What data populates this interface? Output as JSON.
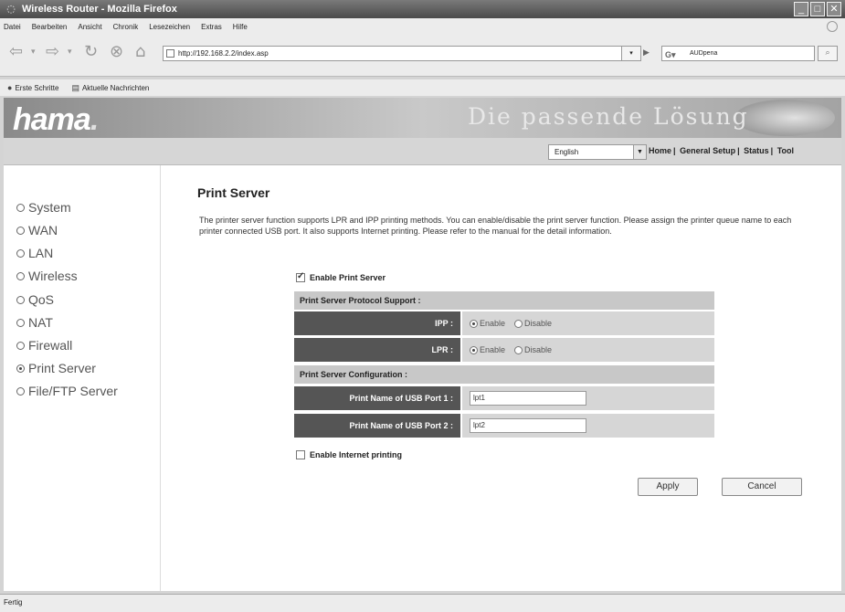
{
  "window": {
    "title": "Wireless Router - Mozilla Firefox"
  },
  "menu": [
    "Datei",
    "Bearbeiten",
    "Ansicht",
    "Chronik",
    "Lesezeichen",
    "Extras",
    "Hilfe"
  ],
  "address": {
    "url": "http://192.168.2.2/index.asp"
  },
  "search": {
    "engine": "G",
    "value": "AUDpena"
  },
  "bookmarks": [
    "Erste Schritte",
    "Aktuelle Nachrichten"
  ],
  "header": {
    "logo": "hama",
    "logo_dot": ".",
    "slogan": "Die passende Lösung",
    "language": "English",
    "nav": [
      "Home",
      "General Setup",
      "Status",
      "Tool"
    ]
  },
  "sidebar": {
    "items": [
      {
        "label": "System",
        "selected": false
      },
      {
        "label": "WAN",
        "selected": false
      },
      {
        "label": "LAN",
        "selected": false
      },
      {
        "label": "Wireless",
        "selected": false
      },
      {
        "label": "QoS",
        "selected": false
      },
      {
        "label": "NAT",
        "selected": false
      },
      {
        "label": "Firewall",
        "selected": false
      },
      {
        "label": "Print Server",
        "selected": true
      },
      {
        "label": "File/FTP Server",
        "selected": false
      }
    ]
  },
  "content": {
    "title": "Print Server",
    "description": "The printer server function supports LPR and IPP printing methods. You can enable/disable the print server function. Please assign the printer queue name to each printer connected USB port. It also supports Internet printing. Please refer to the manual for the detail information.",
    "enable_print_server": {
      "label": "Enable Print Server",
      "checked": true
    },
    "protocol_header": "Print Server Protocol Support :",
    "ipp": {
      "label": "IPP :",
      "enable": "Enable",
      "disable": "Disable",
      "value": "Enable"
    },
    "lpr": {
      "label": "LPR :",
      "enable": "Enable",
      "disable": "Disable",
      "value": "Enable"
    },
    "config_header": "Print Server Configuration :",
    "usb1": {
      "label": "Print Name of USB Port 1 :",
      "value": "lpt1"
    },
    "usb2": {
      "label": "Print Name of USB Port 2 :",
      "value": "lpt2"
    },
    "enable_internet": {
      "label": "Enable Internet printing",
      "checked": false
    },
    "apply_label": "Apply",
    "cancel_label": "Cancel"
  },
  "status": {
    "text": "Fertig"
  }
}
